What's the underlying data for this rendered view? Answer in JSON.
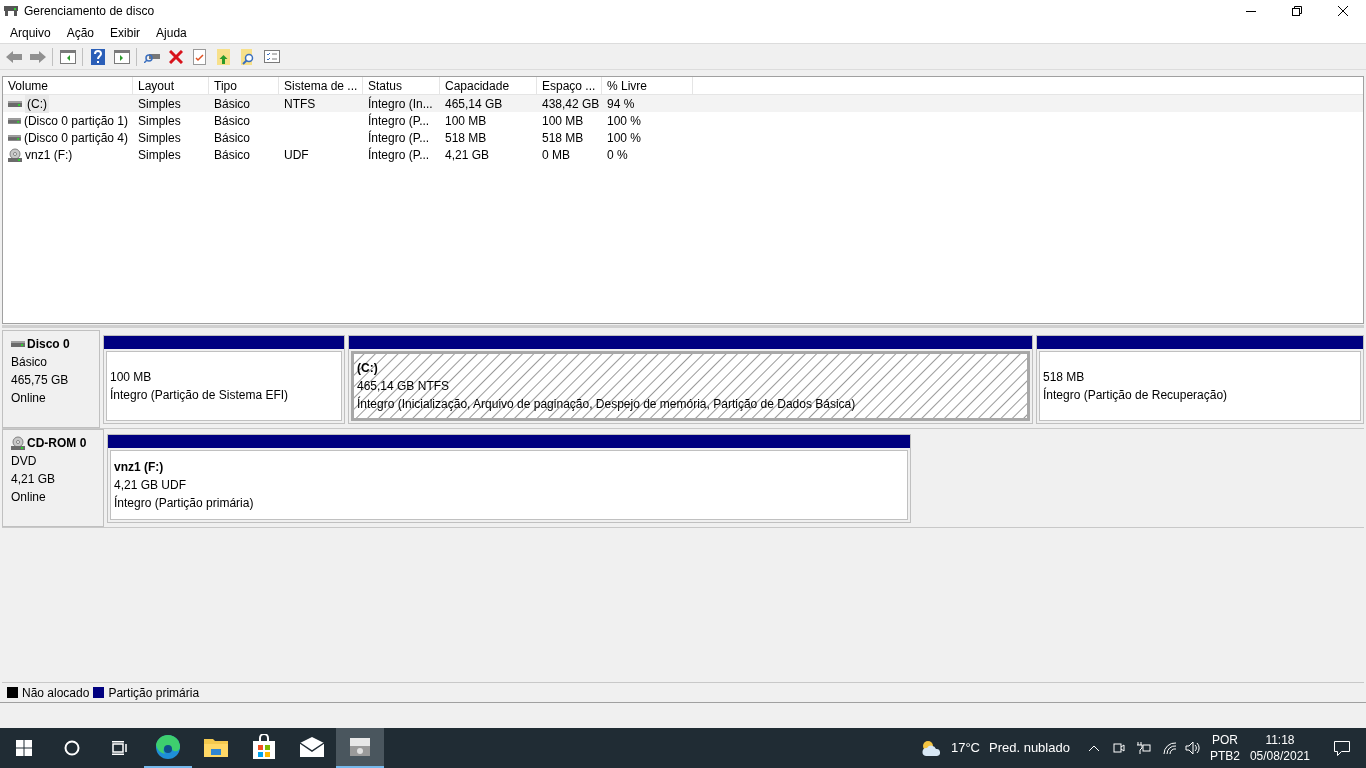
{
  "window": {
    "title": "Gerenciamento de disco"
  },
  "menu": [
    "Arquivo",
    "Ação",
    "Exibir",
    "Ajuda"
  ],
  "volumes": {
    "columns": [
      "Volume",
      "Layout",
      "Tipo",
      "Sistema de ...",
      "Status",
      "Capacidade",
      "Espaço ...",
      "% Livre"
    ],
    "rows": [
      {
        "kind": "disk",
        "selected": true,
        "cells": [
          "(C:)",
          "Simples",
          "Básico",
          "NTFS",
          "Íntegro (In...",
          "465,14 GB",
          "438,42 GB",
          "94 %"
        ]
      },
      {
        "kind": "disk",
        "selected": false,
        "cells": [
          "(Disco 0 partição 1)",
          "Simples",
          "Básico",
          "",
          "Íntegro (P...",
          "100 MB",
          "100 MB",
          "100 %"
        ]
      },
      {
        "kind": "disk",
        "selected": false,
        "cells": [
          "(Disco 0 partição 4)",
          "Simples",
          "Básico",
          "",
          "Íntegro (P...",
          "518 MB",
          "518 MB",
          "100 %"
        ]
      },
      {
        "kind": "cdrom",
        "selected": false,
        "cells": [
          "vnz1 (F:)",
          "Simples",
          "Básico",
          "UDF",
          "Íntegro (P...",
          "4,21 GB",
          "0 MB",
          "0 %"
        ]
      }
    ]
  },
  "disks": [
    {
      "kind": "disk",
      "name": "Disco 0",
      "type": "Básico",
      "size": "465,75 GB",
      "status": "Online",
      "partitions": [
        {
          "size": "100 MB",
          "status": "Íntegro (Partição de Sistema EFI)",
          "selected": false
        },
        {
          "title": "(C:)",
          "size": "465,14 GB NTFS",
          "status": "Íntegro (Inicialização, Arquivo de paginação, Despejo de memória, Partição de Dados Básica)",
          "selected": true
        },
        {
          "size": "518 MB",
          "status": "Íntegro (Partição de Recuperação)",
          "selected": false
        }
      ]
    },
    {
      "kind": "cdrom",
      "name": "CD-ROM 0",
      "type": "DVD",
      "size": "4,21 GB",
      "status": "Online",
      "partitions": [
        {
          "title": "vnz1  (F:)",
          "size": "4,21 GB UDF",
          "status": "Íntegro (Partição primária)",
          "selected": false
        }
      ]
    }
  ],
  "legend": [
    {
      "label": "Não alocado",
      "color": "#000000"
    },
    {
      "label": "Partição primária",
      "color": "#000080"
    }
  ],
  "taskbar": {
    "apps": [
      {
        "kind": "edge",
        "running": true,
        "active": false
      },
      {
        "kind": "explorer",
        "running": false,
        "active": false
      },
      {
        "kind": "store",
        "running": false,
        "active": false
      },
      {
        "kind": "mail",
        "running": false,
        "active": false
      },
      {
        "kind": "diskmgmt",
        "running": true,
        "active": true
      }
    ],
    "weather": {
      "temp": "17°C",
      "text": "Pred. nublado"
    },
    "language": {
      "code": "POR",
      "layout": "PTB2"
    },
    "clock": {
      "time": "11:18",
      "date": "05/08/2021"
    }
  }
}
